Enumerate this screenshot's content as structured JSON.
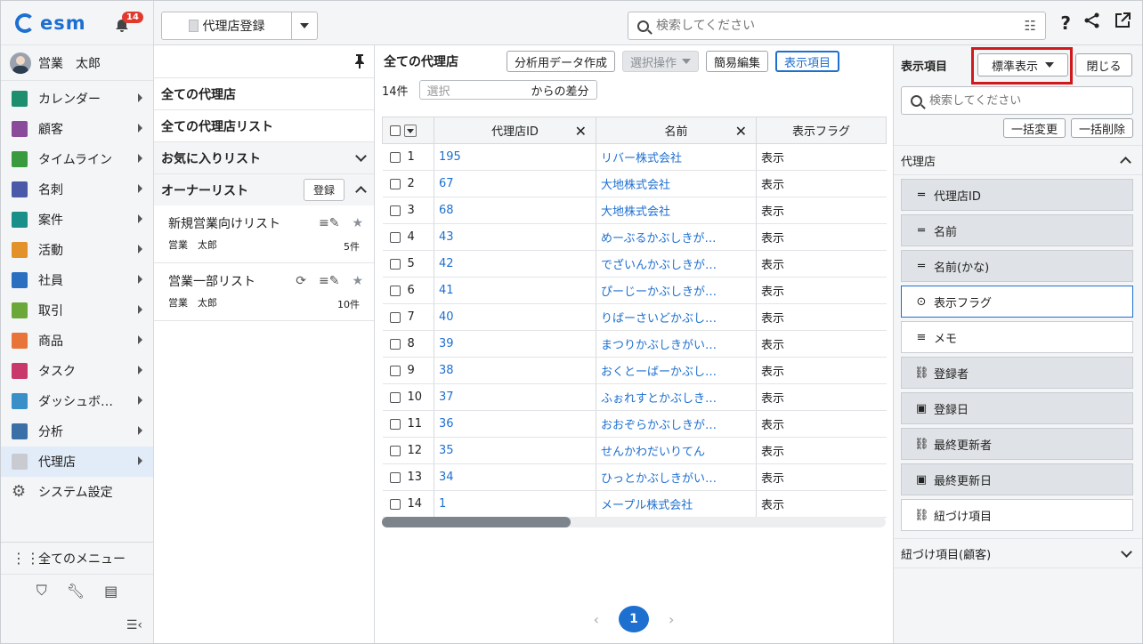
{
  "app": {
    "logo_text": "esm",
    "notification_count": "14",
    "accent": "#1d6fd0"
  },
  "user": {
    "name": "営業　太郎"
  },
  "nav": {
    "items": [
      {
        "label": "カレンダー",
        "icon": "calendar-icon",
        "color": "#1d8f6e"
      },
      {
        "label": "顧客",
        "icon": "building-icon",
        "color": "#8a4b9a"
      },
      {
        "label": "タイムライン",
        "icon": "chat-icon",
        "color": "#3a9a3e"
      },
      {
        "label": "名刺",
        "icon": "card-icon",
        "color": "#4a5aa8"
      },
      {
        "label": "案件",
        "icon": "folder-icon",
        "color": "#1a8f8a"
      },
      {
        "label": "活動",
        "icon": "clipboard-icon",
        "color": "#e3922b"
      },
      {
        "label": "社員",
        "icon": "person-icon",
        "color": "#2a6fc0"
      },
      {
        "label": "取引",
        "icon": "deal-icon",
        "color": "#6aa83a"
      },
      {
        "label": "商品",
        "icon": "box-icon",
        "color": "#e8743a"
      },
      {
        "label": "タスク",
        "icon": "task-icon",
        "color": "#c8386b"
      },
      {
        "label": "ダッシュボ…",
        "icon": "dashboard-icon",
        "color": "#3a8fc8"
      },
      {
        "label": "分析",
        "icon": "chart-icon",
        "color": "#3a6fa8"
      },
      {
        "label": "代理店",
        "icon": "document-icon",
        "color": "#c8ccd2"
      },
      {
        "label": "システム設定",
        "icon": "gear-icon",
        "color": "#555555"
      }
    ],
    "all_menu": "全てのメニュー"
  },
  "topbar": {
    "register_label": "代理店登録",
    "search_placeholder": "検索してください"
  },
  "lists": {
    "all": "全ての代理店",
    "all_list": "全ての代理店リスト",
    "favorites": "お気に入りリスト",
    "owner": "オーナーリスト",
    "register": "登録",
    "saved": [
      {
        "title": "新規営業向けリスト",
        "owner": "営業　太郎",
        "count": "5件"
      },
      {
        "title": "営業一部リスト",
        "owner": "営業　太郎",
        "count": "10件"
      }
    ]
  },
  "main": {
    "title": "全ての代理店",
    "btn_analysis": "分析用データ作成",
    "btn_select_ops": "選択操作",
    "btn_quick_edit": "簡易編集",
    "btn_display": "表示項目",
    "count": "14件",
    "select_placeholder": "選択",
    "diff_label": "からの差分",
    "columns": [
      "代理店ID",
      "名前",
      "表示フラグ"
    ],
    "rows": [
      {
        "n": "1",
        "id": "195",
        "name": "リバー株式会社",
        "flag": "表示"
      },
      {
        "n": "2",
        "id": "67",
        "name": "大地株式会社",
        "flag": "表示"
      },
      {
        "n": "3",
        "id": "68",
        "name": "大地株式会社",
        "flag": "表示"
      },
      {
        "n": "4",
        "id": "43",
        "name": "めーぶるかぶしきが…",
        "flag": "表示"
      },
      {
        "n": "5",
        "id": "42",
        "name": "でざいんかぶしきが…",
        "flag": "表示"
      },
      {
        "n": "6",
        "id": "41",
        "name": "ぴーじーかぶしきが…",
        "flag": "表示"
      },
      {
        "n": "7",
        "id": "40",
        "name": "りばーさいどかぶし…",
        "flag": "表示"
      },
      {
        "n": "8",
        "id": "39",
        "name": "まつりかぶしきがい…",
        "flag": "表示"
      },
      {
        "n": "9",
        "id": "38",
        "name": "おくとーばーかぶし…",
        "flag": "表示"
      },
      {
        "n": "10",
        "id": "37",
        "name": "ふぉれすとかぶしき…",
        "flag": "表示"
      },
      {
        "n": "11",
        "id": "36",
        "name": "おおぞらかぶしきが…",
        "flag": "表示"
      },
      {
        "n": "12",
        "id": "35",
        "name": "せんかわだいりてん",
        "flag": "表示"
      },
      {
        "n": "13",
        "id": "34",
        "name": "ひっとかぶしきがい…",
        "flag": "表示"
      },
      {
        "n": "14",
        "id": "1",
        "name": "メープル株式会社",
        "flag": "表示"
      }
    ],
    "page": "1"
  },
  "display_panel": {
    "title": "表示項目",
    "mode": "標準表示",
    "close": "閉じる",
    "search_placeholder": "検索してください",
    "bulk_change": "一括変更",
    "bulk_delete": "一括削除",
    "section": "代理店",
    "fields": [
      {
        "label": "代理店ID",
        "icon": "text-line-icon",
        "style": "grey"
      },
      {
        "label": "名前",
        "icon": "text-line-icon",
        "style": "grey"
      },
      {
        "label": "名前(かな)",
        "icon": "text-line-icon",
        "style": "grey"
      },
      {
        "label": "表示フラグ",
        "icon": "dropdown-circle-icon",
        "style": "selected"
      },
      {
        "label": "メモ",
        "icon": "multiline-text-icon",
        "style": "white"
      },
      {
        "label": "登録者",
        "icon": "link-icon",
        "style": "grey"
      },
      {
        "label": "登録日",
        "icon": "calendar-icon",
        "style": "grey"
      },
      {
        "label": "最終更新者",
        "icon": "link-icon",
        "style": "grey"
      },
      {
        "label": "最終更新日",
        "icon": "calendar-icon",
        "style": "grey"
      },
      {
        "label": "紐づけ項目",
        "icon": "link-icon",
        "style": "white"
      }
    ],
    "section2": "紐づけ項目(顧客)",
    "highlight_color": "#d0191b"
  }
}
